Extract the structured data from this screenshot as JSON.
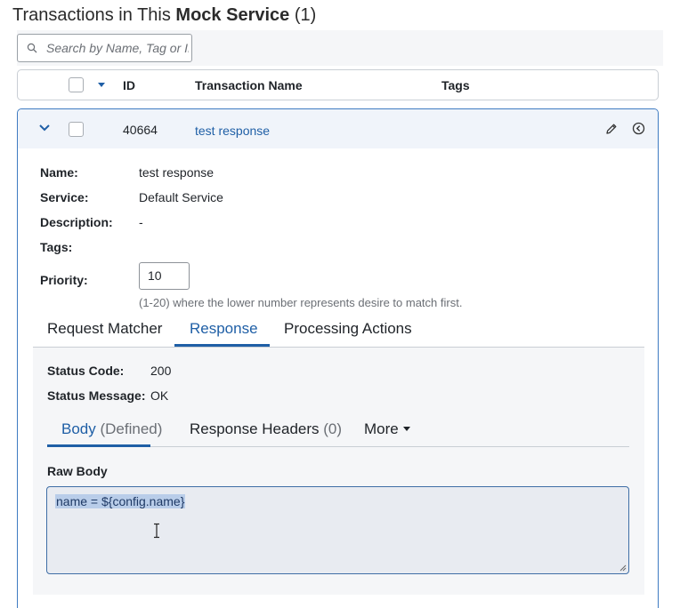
{
  "title": {
    "prefix": "Transactions in This",
    "service": "Mock Service",
    "count": "(1)"
  },
  "search": {
    "placeholder": "Search by Name, Tag or ID",
    "value": ""
  },
  "table": {
    "headers": {
      "id": "ID",
      "name": "Transaction Name",
      "tags": "Tags"
    }
  },
  "transaction": {
    "id": "40664",
    "name_link": "test response",
    "details": {
      "name_label": "Name:",
      "name_value": "test response",
      "service_label": "Service:",
      "service_value": "Default Service",
      "description_label": "Description:",
      "description_value": "-",
      "tags_label": "Tags:",
      "tags_value": "",
      "priority_label": "Priority:",
      "priority_value": "10",
      "priority_hint": "(1-20) where the lower number represents desire to match first."
    },
    "tabs": [
      {
        "label": "Request Matcher",
        "active": false
      },
      {
        "label": "Response",
        "active": true
      },
      {
        "label": "Processing Actions",
        "active": false
      }
    ],
    "response": {
      "status_code_label": "Status Code:",
      "status_code_value": "200",
      "status_message_label": "Status Message:",
      "status_message_value": "OK",
      "subtabs": {
        "body_label": "Body",
        "body_state": "(Defined)",
        "headers_label": "Response Headers",
        "headers_count": "(0)",
        "more_label": "More"
      },
      "raw_body_label": "Raw Body",
      "raw_body_value": "name = ${config.name}"
    }
  },
  "colors": {
    "accent": "#1f5fa6",
    "selection": "#b9cde9",
    "panel": "#f5f6f8"
  },
  "icons": [
    "search-icon",
    "sort-caret-icon",
    "chevron-down-icon",
    "pencil-icon",
    "back-circle-icon",
    "caret-down-icon",
    "text-cursor-icon",
    "resize-grip-icon"
  ]
}
